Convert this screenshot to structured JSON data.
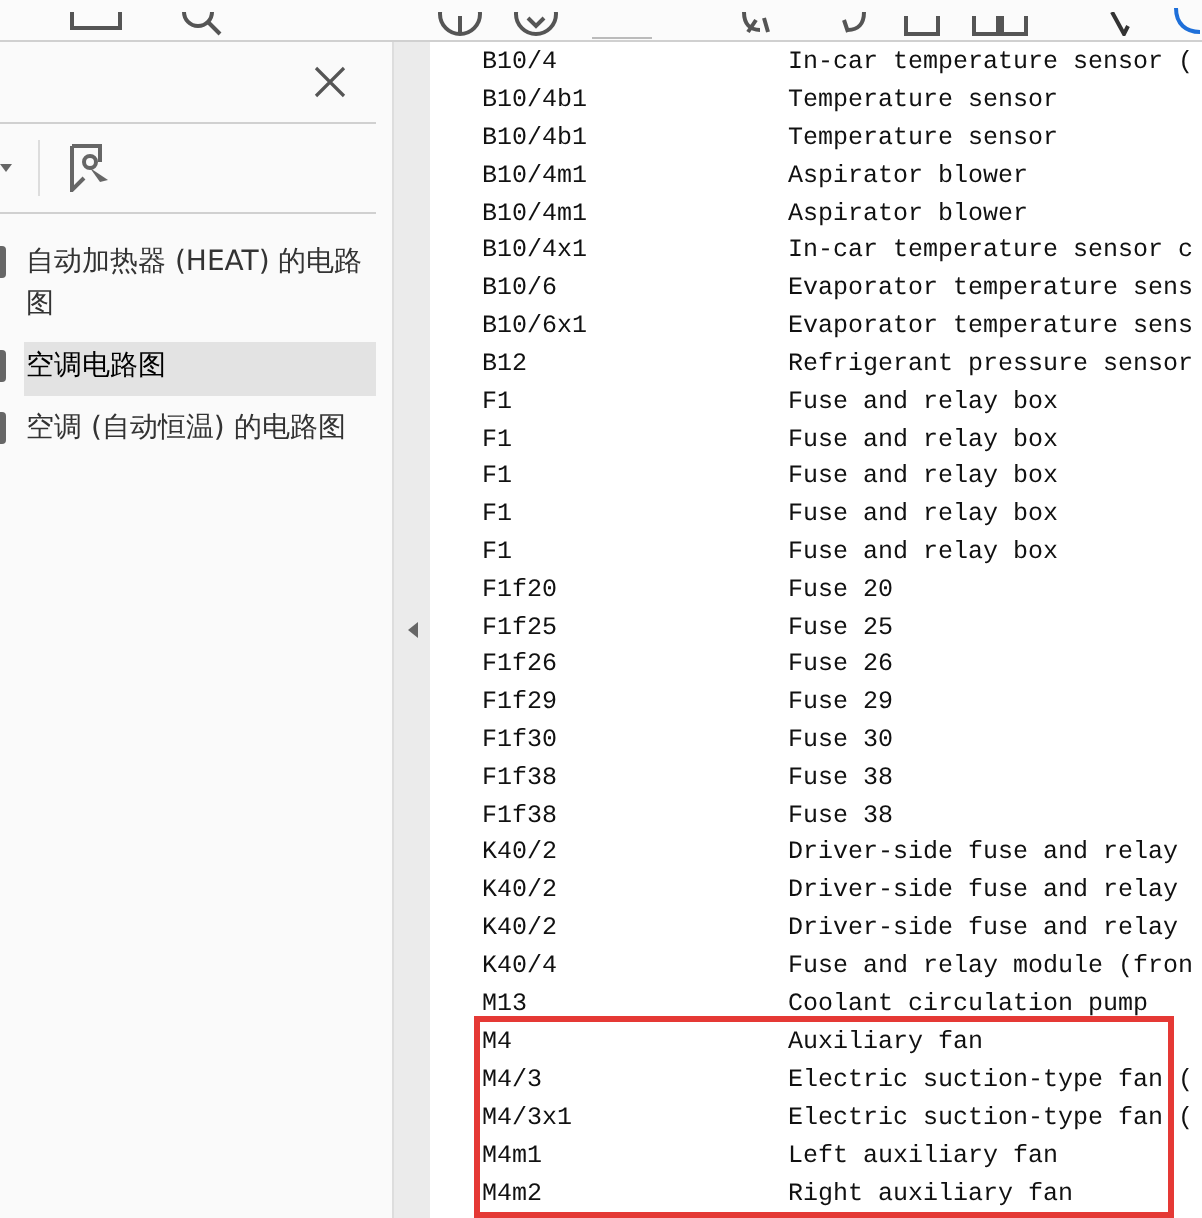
{
  "sidebar": {
    "items": [
      {
        "label": "自动加热器 (HEAT) 的电路图",
        "selected": false
      },
      {
        "label": "空调电路图",
        "selected": true
      },
      {
        "label": "空调 (自动恒温) 的电路图",
        "selected": false
      }
    ]
  },
  "document": {
    "rows": [
      {
        "code": "B10/4",
        "description": "In-car temperature sensor (",
        "highlighted": false
      },
      {
        "code": "B10/4b1",
        "description": "Temperature sensor",
        "highlighted": false
      },
      {
        "code": "B10/4b1",
        "description": "Temperature sensor",
        "highlighted": false
      },
      {
        "code": "B10/4m1",
        "description": "Aspirator blower",
        "highlighted": false
      },
      {
        "code": "B10/4m1",
        "description": "Aspirator blower",
        "highlighted": false
      },
      {
        "code": "B10/4x1",
        "description": "In-car temperature sensor c",
        "highlighted": false
      },
      {
        "code": "B10/6",
        "description": "Evaporator temperature sens",
        "highlighted": false
      },
      {
        "code": "B10/6x1",
        "description": "Evaporator temperature sens",
        "highlighted": false
      },
      {
        "code": "B12",
        "description": "Refrigerant pressure sensor",
        "highlighted": false
      },
      {
        "code": "F1",
        "description": "Fuse and relay box",
        "highlighted": false
      },
      {
        "code": "F1",
        "description": "Fuse and relay box",
        "highlighted": false
      },
      {
        "code": "F1",
        "description": "Fuse and relay box",
        "highlighted": false
      },
      {
        "code": "F1",
        "description": "Fuse and relay box",
        "highlighted": false
      },
      {
        "code": "F1",
        "description": "Fuse and relay box",
        "highlighted": false
      },
      {
        "code": "F1f20",
        "description": "Fuse 20",
        "highlighted": false
      },
      {
        "code": "F1f25",
        "description": "Fuse 25",
        "highlighted": false
      },
      {
        "code": "F1f26",
        "description": "Fuse 26",
        "highlighted": false
      },
      {
        "code": "F1f29",
        "description": "Fuse 29",
        "highlighted": false
      },
      {
        "code": "F1f30",
        "description": "Fuse 30",
        "highlighted": false
      },
      {
        "code": "F1f38",
        "description": "Fuse 38",
        "highlighted": false
      },
      {
        "code": "F1f38",
        "description": "Fuse 38",
        "highlighted": false
      },
      {
        "code": "K40/2",
        "description": "Driver-side fuse and relay",
        "highlighted": false
      },
      {
        "code": "K40/2",
        "description": "Driver-side fuse and relay",
        "highlighted": false
      },
      {
        "code": "K40/2",
        "description": "Driver-side fuse and relay",
        "highlighted": false
      },
      {
        "code": "K40/4",
        "description": "Fuse and relay module (fron",
        "highlighted": false
      },
      {
        "code": "M13",
        "description": "Coolant circulation pump",
        "highlighted": false
      },
      {
        "code": "M4",
        "description": "Auxiliary fan",
        "highlighted": true
      },
      {
        "code": "M4/3",
        "description": "Electric suction-type fan (",
        "highlighted": true
      },
      {
        "code": "M4/3x1",
        "description": "Electric suction-type fan (",
        "highlighted": true
      },
      {
        "code": "M4m1",
        "description": "Left auxiliary fan",
        "highlighted": true
      },
      {
        "code": "M4m2",
        "description": "Right auxiliary fan",
        "highlighted": true
      }
    ]
  }
}
